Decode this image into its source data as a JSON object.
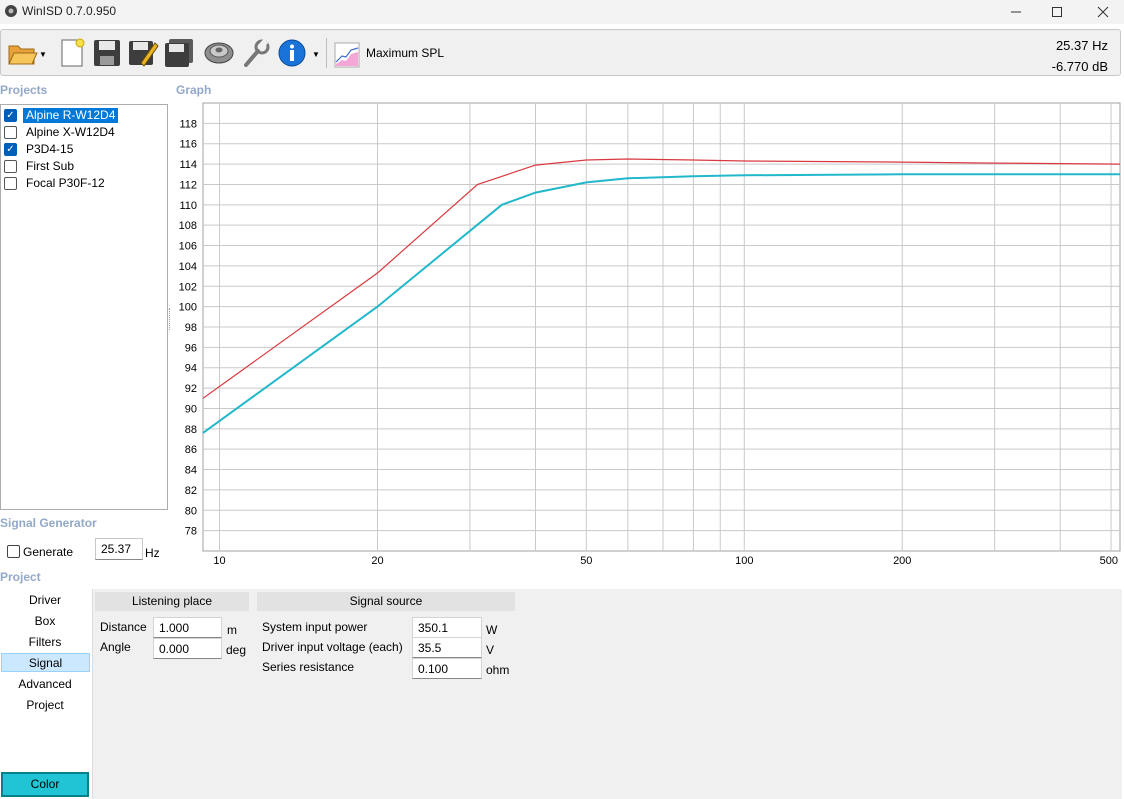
{
  "window": {
    "title": "WinISD 0.7.0.950"
  },
  "toolbar": {
    "buttons": [
      {
        "icon": "open-folder-icon"
      },
      {
        "icon": "new-document-icon"
      },
      {
        "icon": "save-icon"
      },
      {
        "icon": "save-as-icon"
      },
      {
        "icon": "save-all-icon"
      },
      {
        "icon": "driver-speaker-icon"
      },
      {
        "icon": "tools-wrench-icon"
      },
      {
        "icon": "info-icon"
      }
    ],
    "graph_mode": "Maximum SPL",
    "readout_freq": "25.37 Hz",
    "readout_level": "-6.770 dB"
  },
  "projects": {
    "title": "Projects",
    "items": [
      {
        "label": "Alpine R-W12D4",
        "checked": true,
        "selected": true
      },
      {
        "label": "Alpine X-W12D4",
        "checked": false,
        "selected": false
      },
      {
        "label": "P3D4-15",
        "checked": true,
        "selected": false
      },
      {
        "label": "First Sub",
        "checked": false,
        "selected": false
      },
      {
        "label": "Focal P30F-12",
        "checked": false,
        "selected": false
      }
    ]
  },
  "graph": {
    "title": "Graph"
  },
  "chart_data": {
    "type": "line",
    "x_scale": "log",
    "xlim": [
      9.3,
      520
    ],
    "ylim": [
      76,
      120
    ],
    "x_ticks": [
      10,
      20,
      50,
      100,
      200,
      500
    ],
    "y_ticks": [
      78,
      80,
      82,
      84,
      86,
      88,
      90,
      92,
      94,
      96,
      98,
      100,
      102,
      104,
      106,
      108,
      110,
      112,
      114,
      116,
      118
    ],
    "grid": true,
    "series": [
      {
        "color": "#d9393e",
        "x": [
          9.3,
          20,
          31,
          40,
          50,
          60,
          80,
          100,
          200,
          300,
          520
        ],
        "y": [
          91.0,
          103.3,
          112.0,
          113.9,
          114.4,
          114.5,
          114.4,
          114.3,
          114.2,
          114.1,
          114.0
        ]
      },
      {
        "color": "#22b8cc",
        "x": [
          9.3,
          20,
          34.5,
          40,
          50,
          60,
          80,
          100,
          200,
          300,
          520
        ],
        "y": [
          87.6,
          100.0,
          110.0,
          111.2,
          112.2,
          112.6,
          112.8,
          112.9,
          113.0,
          113.0,
          113.0
        ]
      }
    ]
  },
  "signal_generator": {
    "title": "Signal Generator",
    "generate_label": "Generate",
    "frequency_value": "25.37",
    "frequency_unit": "Hz"
  },
  "project_panel": {
    "title": "Project",
    "nav": [
      "Driver",
      "Box",
      "Filters",
      "Signal",
      "Advanced",
      "Project"
    ],
    "active_nav": "Signal",
    "color_button": "Color",
    "color_value": "#21c4d4",
    "listening_place": {
      "header": "Listening place",
      "distance_label": "Distance",
      "distance_value": "1.000",
      "distance_unit": "m",
      "angle_label": "Angle",
      "angle_value": "0.000",
      "angle_unit": "deg"
    },
    "signal_source": {
      "header": "Signal source",
      "power_label": "System input power",
      "power_value": "350.1",
      "power_unit": "W",
      "voltage_label": "Driver input voltage (each)",
      "voltage_value": "35.5",
      "voltage_unit": "V",
      "resistance_label": "Series resistance",
      "resistance_value": "0.100",
      "resistance_unit": "ohm"
    }
  }
}
